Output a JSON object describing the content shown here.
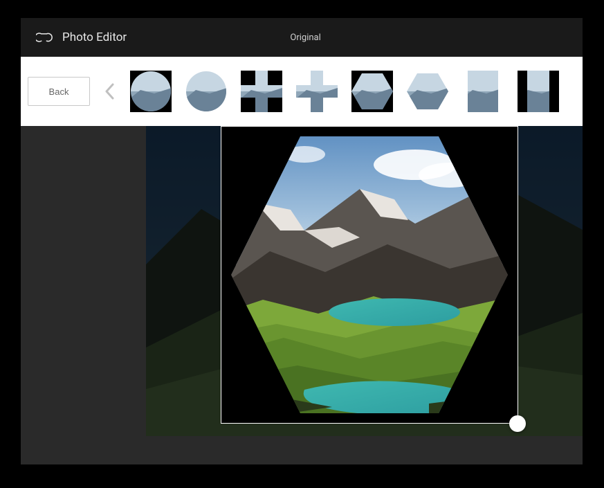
{
  "header": {
    "title": "Photo Editor",
    "tab_label": "Original"
  },
  "toolbar": {
    "back_label": "Back",
    "frames": [
      {
        "id": "circle-1",
        "name": "circle-frame"
      },
      {
        "id": "circle-2",
        "name": "circle-soft-frame"
      },
      {
        "id": "plus-1",
        "name": "plus-frame"
      },
      {
        "id": "plus-2",
        "name": "plus-soft-frame"
      },
      {
        "id": "hexagon-1",
        "name": "hexagon-frame"
      },
      {
        "id": "hexagon-2",
        "name": "hexagon-soft-frame"
      },
      {
        "id": "square-1",
        "name": "square-frame"
      },
      {
        "id": "bars-1",
        "name": "bars-frame"
      }
    ]
  },
  "canvas": {
    "selected_frame": "hexagon-1"
  }
}
